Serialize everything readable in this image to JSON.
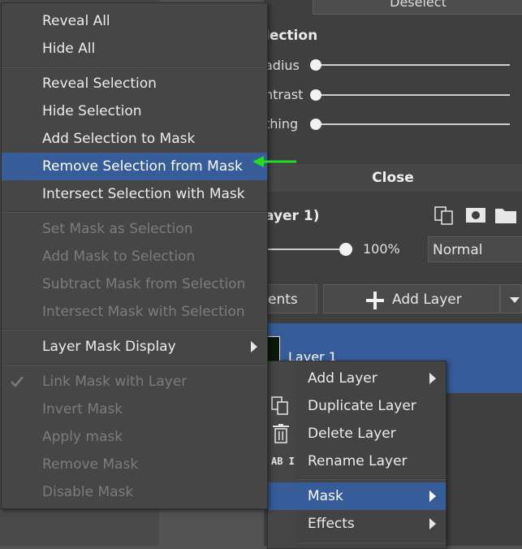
{
  "background": {
    "deselect_label": "Deselect",
    "section_title": "lection",
    "sliders": [
      {
        "label": "adius"
      },
      {
        "label": "ntrast"
      },
      {
        "label": "thing"
      }
    ],
    "close_label": "Close",
    "layer_title": "ayer 1)",
    "opacity_value": "100%",
    "blend_mode": "Normal",
    "adjustments_label": "ents",
    "add_layer_label": "Add Layer",
    "layer_name": "Layer 1"
  },
  "mask_menu": {
    "items": [
      {
        "label": "Reveal All",
        "enabled": true
      },
      {
        "label": "Hide All",
        "enabled": true
      },
      {
        "label": "Reveal Selection",
        "enabled": true
      },
      {
        "label": "Hide Selection",
        "enabled": true
      },
      {
        "label": "Add Selection to Mask",
        "enabled": true
      },
      {
        "label": "Remove Selection from Mask",
        "enabled": true,
        "highlighted": true
      },
      {
        "label": "Intersect Selection with Mask",
        "enabled": true
      },
      {
        "label": "Set Mask as Selection",
        "enabled": false
      },
      {
        "label": "Add Mask to Selection",
        "enabled": false
      },
      {
        "label": "Subtract Mask from Selection",
        "enabled": false
      },
      {
        "label": "Intersect Mask with Selection",
        "enabled": false
      },
      {
        "label": "Layer Mask Display",
        "enabled": true,
        "submenu": true
      },
      {
        "label": "Link Mask with Layer",
        "enabled": false,
        "checked": true
      },
      {
        "label": "Invert Mask",
        "enabled": false
      },
      {
        "label": "Apply mask",
        "enabled": false
      },
      {
        "label": "Remove Mask",
        "enabled": false
      },
      {
        "label": "Disable Mask",
        "enabled": false
      }
    ]
  },
  "layer_context_menu": {
    "items": [
      {
        "label": "Add Layer",
        "submenu": true
      },
      {
        "label": "Duplicate Layer",
        "icon": "duplicate-icon"
      },
      {
        "label": "Delete Layer",
        "icon": "trash-icon"
      },
      {
        "label": "Rename Layer",
        "icon": "rename-icon",
        "icon_text": "AB I"
      },
      {
        "label": "Mask",
        "submenu": true,
        "highlighted": true
      },
      {
        "label": "Effects",
        "submenu": true
      }
    ]
  },
  "colors": {
    "highlight": "#365c99",
    "annotation_arrow": "#22dd22",
    "menu_bg": "#464646",
    "disabled_text": "#7c7c7c"
  }
}
